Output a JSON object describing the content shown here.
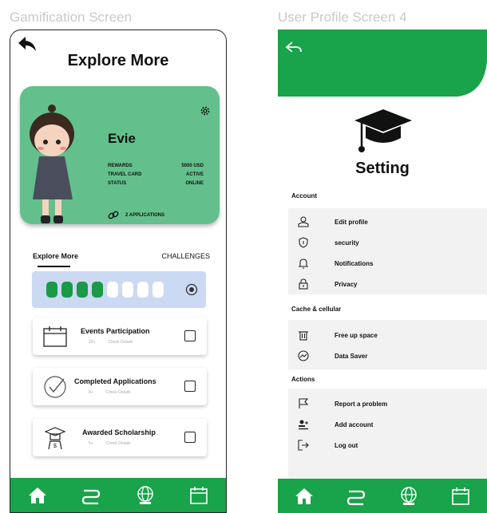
{
  "captions": {
    "left": "Gamification Screen",
    "right": "User Profile Screen 4"
  },
  "gamification": {
    "title": "Explore More",
    "card": {
      "name": "Evie",
      "stats": [
        {
          "label": "REWARDS",
          "value": "5000 USD"
        },
        {
          "label": "TRAVEL CARD",
          "value": "ACTIVE"
        },
        {
          "label": "STATUS",
          "value": "ONLINE"
        }
      ],
      "applications": "2 APPLICATIONS"
    },
    "tabs": [
      "Explore More",
      "CHALLENGES"
    ],
    "progress": {
      "filled": 4,
      "total": 8
    },
    "tasks": [
      {
        "title": "Events Participation",
        "count": "15+",
        "link": "Check Details",
        "icon": "calendar-icon"
      },
      {
        "title": "Completed Applications",
        "count": "8+",
        "link": "Check Details",
        "icon": "check-circle-icon"
      },
      {
        "title": "Awarded Scholarship",
        "count": "5+",
        "link": "Check Details",
        "icon": "scholar-icon"
      }
    ]
  },
  "settings": {
    "title": "Setting",
    "sections": [
      {
        "title": "Account",
        "items": [
          {
            "label": "Edit profile",
            "icon": "user-icon"
          },
          {
            "label": "security",
            "icon": "shield-icon"
          },
          {
            "label": "Notifications",
            "icon": "bell-icon"
          },
          {
            "label": "Privacy",
            "icon": "lock-icon"
          }
        ]
      },
      {
        "title": "Cache & cellular",
        "items": [
          {
            "label": "Free up space",
            "icon": "trash-icon"
          },
          {
            "label": "Data Saver",
            "icon": "gauge-icon"
          }
        ]
      },
      {
        "title": "Actions",
        "items": [
          {
            "label": "Report a problem",
            "icon": "flag-icon"
          },
          {
            "label": "Add account",
            "icon": "add-user-icon"
          },
          {
            "label": "Log out",
            "icon": "logout-icon"
          }
        ]
      }
    ]
  },
  "nav": [
    "home-icon",
    "route-icon",
    "globe-icon",
    "calendar-icon"
  ],
  "colors": {
    "green": "#19a34a",
    "card_green": "#63c08c",
    "progress_bg": "#cbd9f3"
  }
}
